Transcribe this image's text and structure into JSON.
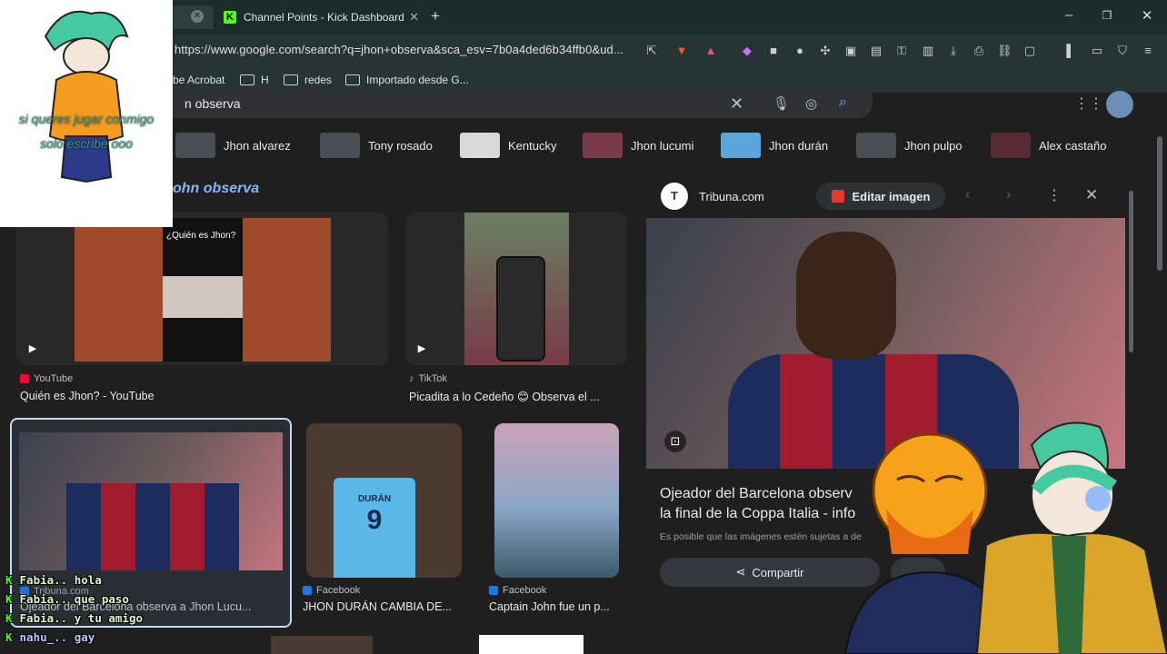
{
  "browser": {
    "tabs": [
      {
        "label": "Channel Points - Kick Dashboard",
        "icon": "kick-icon"
      }
    ],
    "new_tab": "+",
    "window_controls": [
      "–",
      "❐",
      "✕"
    ],
    "url": "https://www.google.com/search?q=jhon+observa&sca_esv=7b0a4ded6b34ffb0&ud...",
    "bookmarks": [
      "be Acrobat",
      "H",
      "redes",
      "Importado desde G..."
    ]
  },
  "search": {
    "query": "n observa",
    "chips": [
      "Jhon alvarez",
      "Tony rosado",
      "Kentucky",
      "Jhon lucumi",
      "Jhon durán",
      "Jhon pulpo",
      "Alex castaño"
    ],
    "heading": "ohn observa"
  },
  "results": [
    {
      "source": "YouTube",
      "title": "Quién es Jhon? - YouTube",
      "thumb_caption": "¿Quién es Jhon?",
      "source_color": "#ff0033"
    },
    {
      "source": "TikTok",
      "title": "Picadita a lo Cedeño 😊 Observa el ...",
      "source_color": "#e8eaed"
    },
    {
      "source": "Tribuna.com",
      "title": "Ojeador del Barcelona observa a Jhon Lucu...",
      "source_color": "#1a73e8"
    },
    {
      "source": "Facebook",
      "title": "JHON DURÁN CAMBIA DE...",
      "source_color": "#1877f2",
      "jersey": "DURÁN",
      "jersey_number": "9"
    },
    {
      "source": "Facebook",
      "title": "Captain John fue un p...",
      "source_color": "#1877f2"
    }
  ],
  "preview": {
    "site": "Tribuna.com",
    "edit_button": "Editar imagen",
    "headline_line1": "Ojeador del Barcelona observ",
    "headline_line2": "la final de la Coppa Italia - info",
    "notice": "Es posible que las imágenes estén sujetas a de",
    "share_button": "Compartir"
  },
  "overlay": {
    "text": "si queres jugar conmigo solo escribe ooo"
  },
  "chat": [
    {
      "user": "Fabia..",
      "message": "hola"
    },
    {
      "user": "Fabia..",
      "message": "que paso"
    },
    {
      "user": "Fabia..",
      "message": "y tu amigo"
    },
    {
      "user": "nahu_..",
      "message": "gay"
    }
  ]
}
